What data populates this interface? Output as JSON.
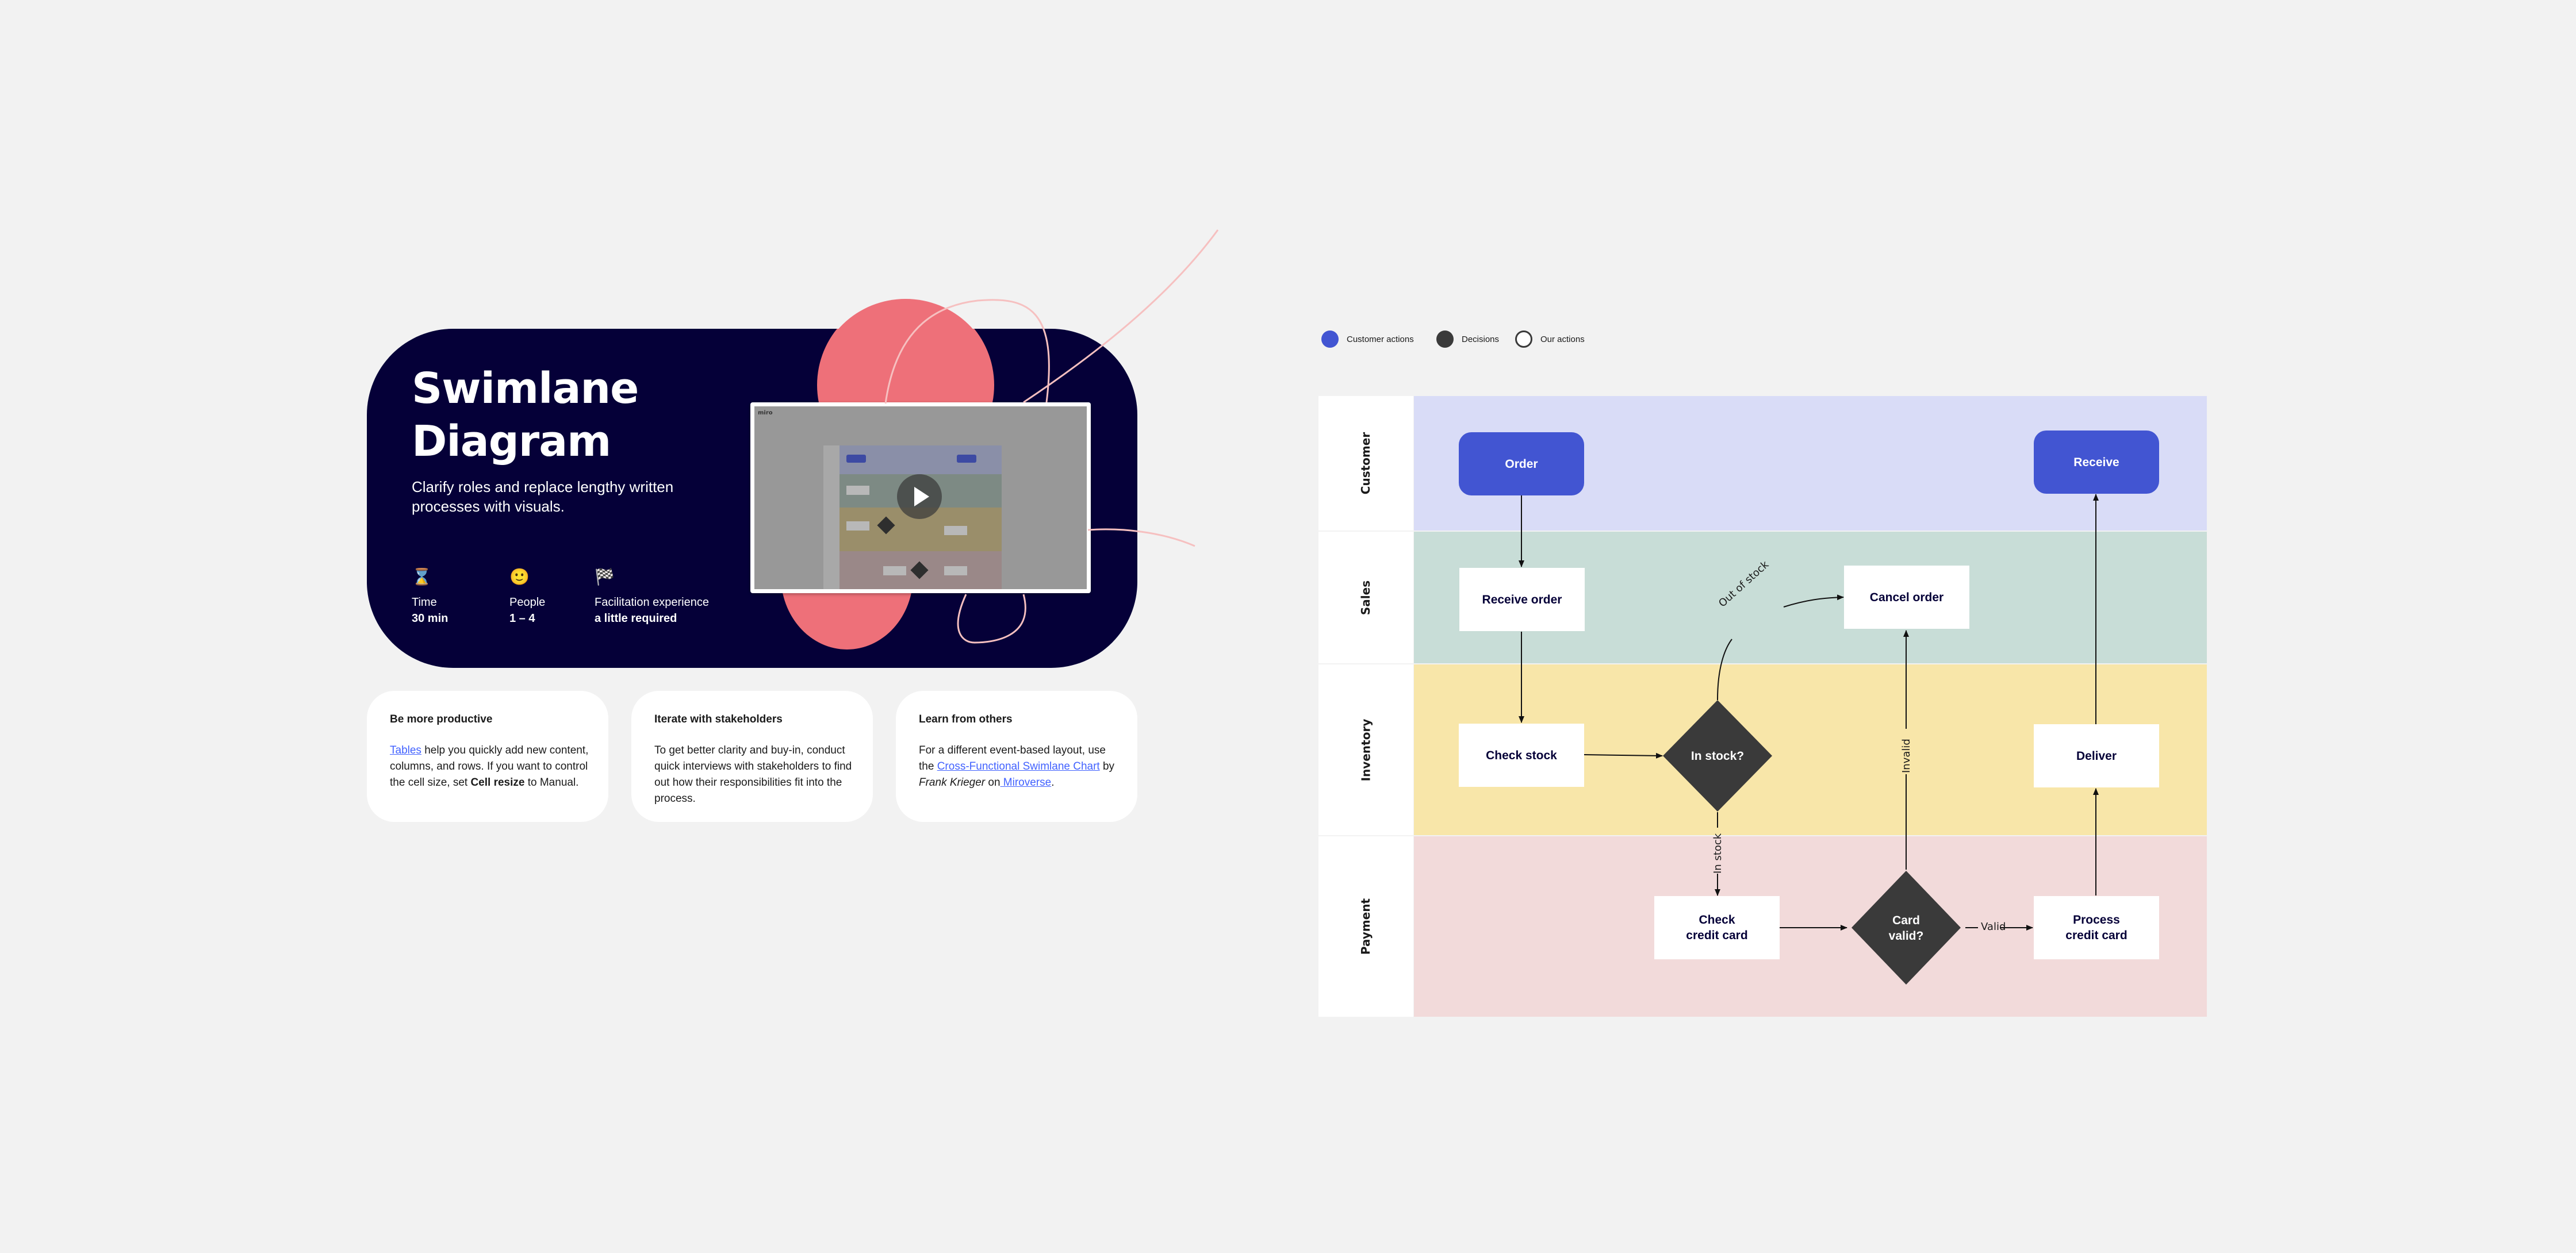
{
  "hero": {
    "title_line1": "Swimlane",
    "title_line2": "Diagram",
    "subtitle": "Clarify roles and replace lengthy written processes with visuals.",
    "meta": [
      {
        "icon": "hourglass-icon",
        "glyph": "⌛",
        "label": "Time",
        "value": "30 min"
      },
      {
        "icon": "smiley-icon",
        "glyph": "🙂",
        "label": "People",
        "value": "1 – 4"
      },
      {
        "icon": "checkered-flag-icon",
        "glyph": "🏁",
        "label": "Facilitation experience",
        "value": "a little required"
      }
    ],
    "video": {
      "app_logo": "miro",
      "play_icon": "play-icon"
    }
  },
  "cards": [
    {
      "title": "Be more productive",
      "link": "Tables",
      "text_after_link": " help you quickly add new content, columns, and rows. If you want to control the cell size, set ",
      "bold": "Cell resize",
      "text_end": " to Manual."
    },
    {
      "title": "Iterate with stakeholders",
      "text": "To get better clarity and buy-in, conduct quick interviews with stakeholders to find out how their responsibilities fit into the process."
    },
    {
      "title": "Learn from others",
      "text_start": "For a different event-based layout, use the ",
      "link1": "Cross-Functional Swimlane Chart",
      "text_by": " by ",
      "author": "Frank Krieger",
      "text_on": " on",
      "link2": " Miroverse",
      "text_end": "."
    }
  ],
  "legend": [
    {
      "label": "Customer actions",
      "color": "#4255d2"
    },
    {
      "label": "Decisions",
      "color": "#3a3a3a"
    },
    {
      "label": "Our actions",
      "color": "#ffffff"
    }
  ],
  "lanes": [
    {
      "label": "Customer",
      "color": "#d9dcf7"
    },
    {
      "label": "Sales",
      "color": "#c8ddd7"
    },
    {
      "label": "Inventory",
      "color": "#f8e6a9"
    },
    {
      "label": "Payment",
      "color": "#f2dada"
    }
  ],
  "nodes": {
    "order": "Order",
    "receive": "Receive",
    "receive_order": "Receive order",
    "cancel_order": "Cancel order",
    "check_stock": "Check stock",
    "in_stock_q": "In stock?",
    "deliver": "Deliver",
    "check_credit_card": "Check\ncredit card",
    "card_valid_q": "Card\nvalid?",
    "process_credit_card": "Process\ncredit card"
  },
  "edge_labels": {
    "out_of_stock": "Out of stock",
    "in_stock": "In stock",
    "invalid": "Invalid",
    "valid": "Valid"
  },
  "colors": {
    "hero_bg": "#050038",
    "accent_pink": "#ee7079",
    "customer_blue": "#4255d2",
    "decision_dark": "#3a3a3a",
    "link_blue": "#4262ff"
  }
}
